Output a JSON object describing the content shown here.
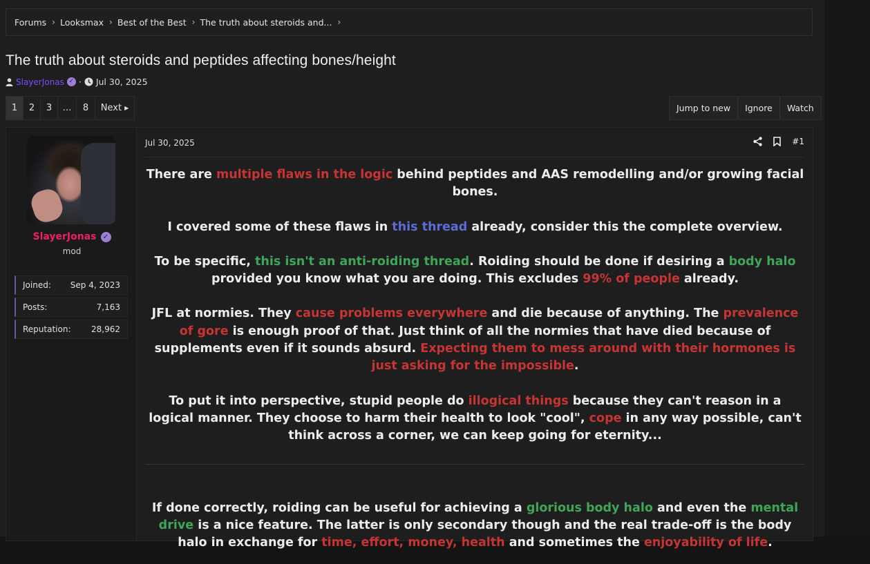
{
  "breadcrumb": {
    "items": [
      "Forums",
      "Looksmax",
      "Best of the Best",
      "The truth about steroids and..."
    ]
  },
  "thread": {
    "title": "The truth about steroids and peptides affecting bones/height",
    "author": "SlayerJonas",
    "separator": "·",
    "date": "Jul 30, 2025"
  },
  "pagination": {
    "pages": [
      "1",
      "2",
      "3",
      "…",
      "8"
    ],
    "next_label": "Next",
    "active": "1"
  },
  "thread_actions": {
    "jump": "Jump to new",
    "ignore": "Ignore",
    "watch": "Watch"
  },
  "user": {
    "name": "SlayerJonas",
    "role": "mod",
    "stats": [
      {
        "label": "Joined:",
        "value": "Sep 4, 2023"
      },
      {
        "label": "Posts:",
        "value": "7,163"
      },
      {
        "label": "Reputation:",
        "value": "28,962"
      }
    ]
  },
  "post": {
    "date": "Jul 30, 2025",
    "number": "#1",
    "p1": [
      "There are ",
      "multiple flaws in the logic",
      " behind peptides and AAS remodelling and/or growing facial bones."
    ],
    "p2": [
      "I covered some of these flaws in ",
      "this thread",
      " already, consider this the complete overview."
    ],
    "p3": [
      "To be specific, ",
      "this isn't an anti-roiding thread",
      ". Roiding should be done if desiring a ",
      "body halo",
      " provided you know what you are doing. This excludes ",
      "99% of people",
      " already."
    ],
    "p4": [
      "JFL at normies. They ",
      "cause problems everywhere",
      " and die because of anything. The ",
      "prevalence of gore",
      " is enough proof of that. Just think of all the normies that have died because of supplements even if it sounds absurd. ",
      "Expecting them to mess around with their hormones is just asking for the impossible",
      "."
    ],
    "p5": [
      "To put it into perspective, stupid people do ",
      "illogical things",
      " because they can't reason in a logical manner. They choose to harm their health to look \"cool\", ",
      "cope",
      " in any way possible, can't think across a corner, we can keep going for eternity..."
    ],
    "p6": [
      "If done correctly, roiding can be useful for achieving a ",
      "glorious body halo",
      " and even the ",
      "mental drive",
      " is a nice feature. The latter is only secondary though and the real trade-off is the body halo in exchange for ",
      "time, effort, money, health",
      " and sometimes the ",
      "enjoyability of life",
      "."
    ]
  },
  "colors": {
    "red": "#c73434",
    "green": "#3fa55a",
    "blue": "#5c6bd6",
    "username": "#ec1f6b",
    "author_link": "#7c4dff"
  },
  "icons": [
    "user-icon",
    "verified-icon",
    "clock-icon",
    "chevron-right-icon",
    "caret-right-icon",
    "share-icon",
    "bookmark-icon"
  ]
}
